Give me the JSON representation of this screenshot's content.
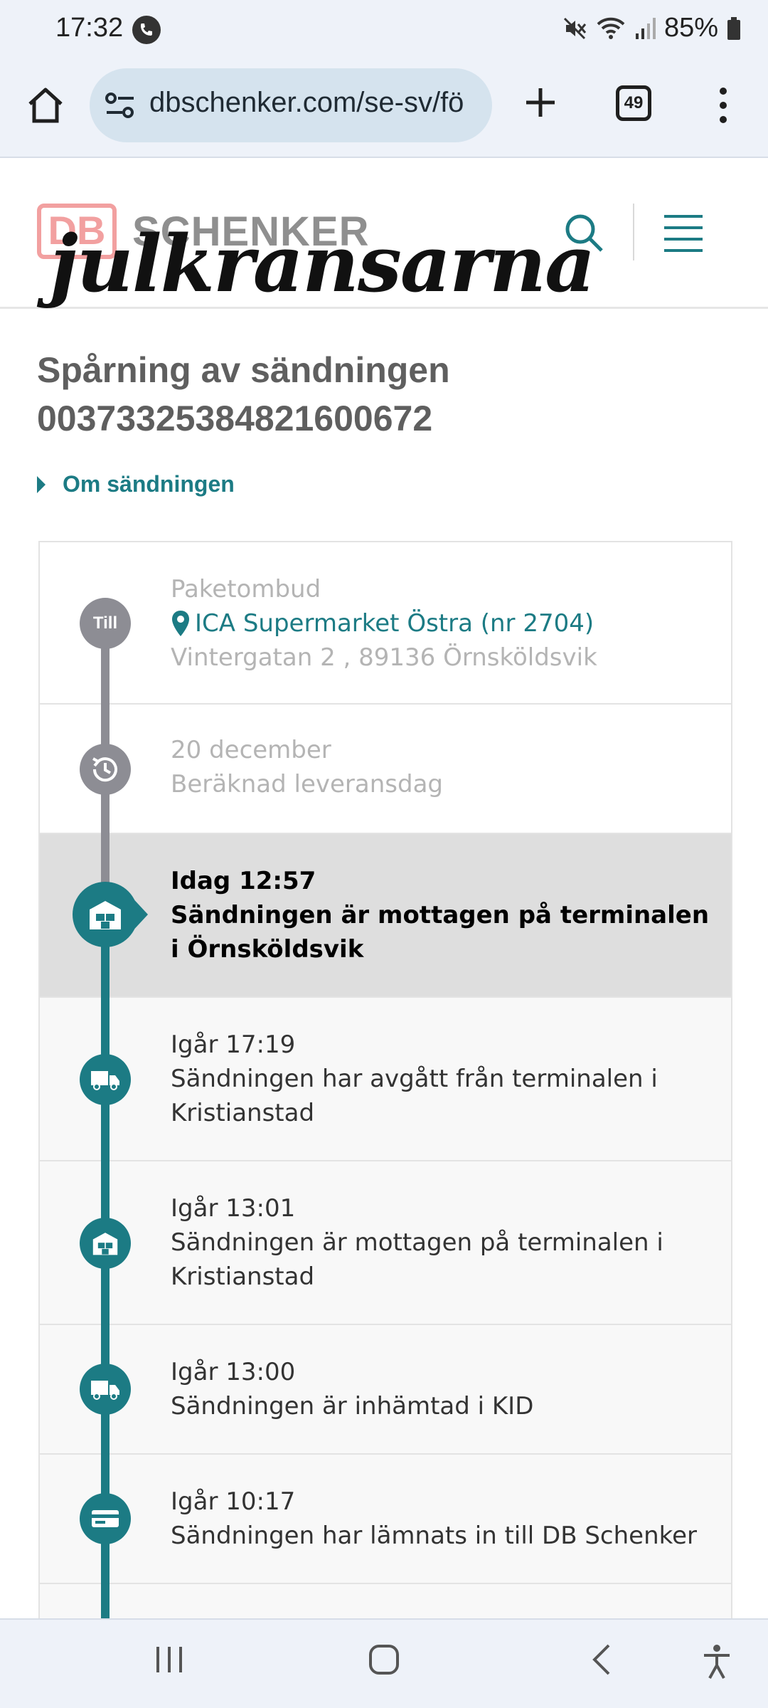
{
  "status_bar": {
    "time": "17:32",
    "battery": "85%",
    "icons": [
      "call-icon",
      "mute-icon",
      "wifi-icon",
      "signal-icon",
      "battery-icon"
    ]
  },
  "browser": {
    "url": "dbschenker.com/se-sv/fö",
    "tab_count": "49",
    "icons": [
      "home-icon",
      "site-settings-icon",
      "new-tab-icon",
      "tab-switcher-icon",
      "more-menu-icon"
    ]
  },
  "header": {
    "logo_db": "DB",
    "logo_text": "SCHENKER",
    "overlay_text": "julkransarna",
    "icons": [
      "search-icon",
      "menu-icon"
    ]
  },
  "page": {
    "title_line1": "Spårning av sändningen",
    "title_line2": "00373325384821600672",
    "about_link": "Om sändningen"
  },
  "timeline": {
    "destination": {
      "badge": "Till",
      "label": "Paketombud",
      "location": "ICA Supermarket Östra (nr 2704)",
      "address": "Vintergatan 2 , 89136 Örnsköldsvik"
    },
    "estimate": {
      "date": "20 december",
      "label": "Beräknad leveransdag"
    },
    "events": [
      {
        "time": "Idag 12:57",
        "text": "Sändningen är mottagen på terminalen i Örnsköldsvik",
        "icon": "warehouse-icon"
      },
      {
        "time": "Igår 17:19",
        "text": "Sändningen har avgått från terminalen i Kristianstad",
        "icon": "truck-icon"
      },
      {
        "time": "Igår 13:01",
        "text": "Sändningen är mottagen på terminalen i Kristianstad",
        "icon": "warehouse-icon"
      },
      {
        "time": "Igår 13:00",
        "text": "Sändningen är inhämtad i KID",
        "icon": "truck-icon"
      },
      {
        "time": "Igår 10:17",
        "text": "Sändningen har lämnats in till DB Schenker",
        "icon": "card-icon"
      }
    ]
  },
  "colors": {
    "teal": "#1c7b84",
    "gray_line": "#8d8d94",
    "logo_red": "#f2a0a0"
  }
}
